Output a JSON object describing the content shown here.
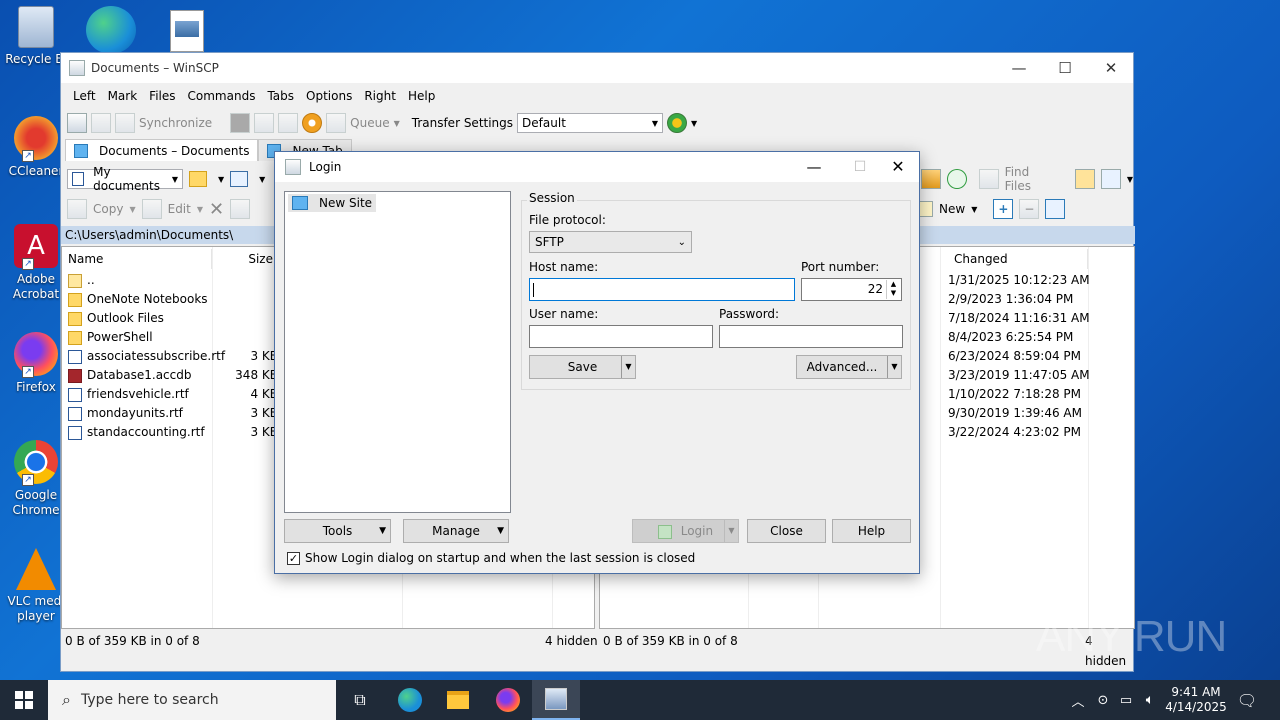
{
  "desktop": {
    "icons": [
      {
        "label": "Recycle Bin",
        "label_lines": [
          "Recycle Bi"
        ]
      },
      {
        "label": "CCleaner",
        "label_lines": [
          "CCleaner"
        ]
      },
      {
        "label": "Adobe Acrobat",
        "label_lines": [
          "Adobe",
          "Acrobat"
        ]
      },
      {
        "label": "Firefox",
        "label_lines": [
          "Firefox"
        ]
      },
      {
        "label": "Google Chrome",
        "label_lines": [
          "Google",
          "Chrome"
        ]
      },
      {
        "label": "VLC media player",
        "label_lines": [
          "VLC medi",
          "player"
        ]
      }
    ]
  },
  "winscp": {
    "title": "Documents – WinSCP",
    "menu": [
      "Left",
      "Mark",
      "Files",
      "Commands",
      "Tabs",
      "Options",
      "Right",
      "Help"
    ],
    "toolbar": {
      "synchronize": "Synchronize",
      "queue": "Queue",
      "transfer_settings_label": "Transfer Settings",
      "transfer_settings_value": "Default",
      "find_files": "Find Files",
      "copy": "Copy",
      "edit": "Edit",
      "new": "New"
    },
    "tabs": [
      {
        "label": "Documents – Documents"
      },
      {
        "label": "New Tab"
      }
    ],
    "left_panel": {
      "location": "My documents",
      "path": "C:\\Users\\admin\\Documents\\",
      "columns": [
        "Name",
        "Size"
      ],
      "files": [
        {
          "name": "..",
          "size": "",
          "type": "up"
        },
        {
          "name": "OneNote Notebooks",
          "size": "",
          "type": "folder"
        },
        {
          "name": "Outlook Files",
          "size": "",
          "type": "folder"
        },
        {
          "name": "PowerShell",
          "size": "",
          "type": "folder"
        },
        {
          "name": "associatessubscribe.rtf",
          "size": "3 KB",
          "type": "doc"
        },
        {
          "name": "Database1.accdb",
          "size": "348 KB",
          "type": "db"
        },
        {
          "name": "friendsvehicle.rtf",
          "size": "4 KB",
          "type": "doc"
        },
        {
          "name": "mondayunits.rtf",
          "size": "3 KB",
          "type": "doc"
        },
        {
          "name": "standaccounting.rtf",
          "size": "3 KB",
          "type": "doc"
        }
      ],
      "status": "0 B of 359 KB in 0 of 8",
      "hidden": "4 hidden"
    },
    "right_panel": {
      "column_changed": "Changed",
      "changed": [
        "1/31/2025 10:12:23 AM",
        "2/9/2023 1:36:04 PM",
        "7/18/2024 11:16:31 AM",
        "8/4/2023 6:25:54 PM",
        "6/23/2024 8:59:04 PM",
        "3/23/2019 11:47:05 AM",
        "1/10/2022 7:18:28 PM",
        "9/30/2019 1:39:46 AM",
        "3/22/2024 4:23:02 PM"
      ],
      "status": "0 B of 359 KB in 0 of 8",
      "hidden": "4 hidden"
    }
  },
  "login": {
    "title": "Login",
    "site_tree": [
      "New Site"
    ],
    "session_group": "Session",
    "file_protocol_label": "File protocol:",
    "file_protocol_value": "SFTP",
    "host_label": "Host name:",
    "host_value": "",
    "port_label": "Port number:",
    "port_value": "22",
    "user_label": "User name:",
    "user_value": "",
    "password_label": "Password:",
    "password_value": "",
    "save": "Save",
    "advanced": "Advanced...",
    "tools": "Tools",
    "manage": "Manage",
    "login": "Login",
    "close": "Close",
    "help": "Help",
    "startup_checkbox": "Show Login dialog on startup and when the last session is closed",
    "startup_checked": true
  },
  "taskbar": {
    "search_placeholder": "Type here to search",
    "time": "9:41 AM",
    "date": "4/14/2025"
  },
  "watermark": "ANY RUN"
}
